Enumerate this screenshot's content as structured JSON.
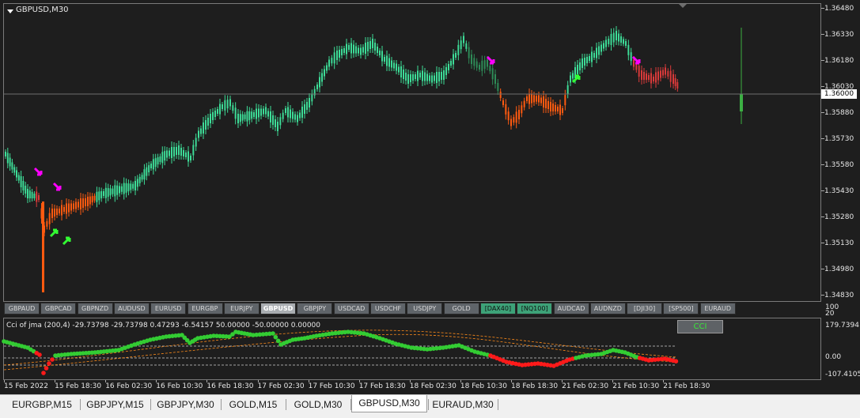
{
  "chart": {
    "symbol_label": "GBPUSD,M30",
    "current_price": "1.36000",
    "colors": {
      "background": "#1e1e1e",
      "bull_candle": "#3ddc97",
      "bear_candle": "#ff5a10",
      "neutral_candle": "#2e8b57",
      "down_arrow": "#ff00ff",
      "up_arrow": "#33ff33"
    },
    "price_axis": [
      "1.36480",
      "1.36330",
      "1.36180",
      "1.36030",
      "1.35880",
      "1.35730",
      "1.35580",
      "1.35430",
      "1.35280",
      "1.35130",
      "1.34980",
      "1.34830"
    ]
  },
  "symbol_buttons": [
    "GBPAUD",
    "GBPCAD",
    "GBPNZD",
    "AUDUSD",
    "EURUSD",
    "EURGBP",
    "EURJPY",
    "GBPUSD",
    "GBPJPY",
    "USDCAD",
    "USDCHF",
    "USDJPY",
    "GOLD",
    "[DAX40]",
    "[NQ100]",
    "AUDCAD",
    "AUDNZD",
    "[DJI30]",
    "[SP500]",
    "EURAUD"
  ],
  "symbol_buttons_active": "GBPUSD",
  "symbol_buttons_green": [
    "[DAX40]",
    "[NQ100]"
  ],
  "indicator": {
    "title": "Cci of jma (200,4) -29.73798 -29.73798 0.47293 -6.54157 50.00000 -50.00000 0.00000",
    "button_label": "CCI",
    "axis": [
      "100",
      "20",
      "179.73941",
      "0.00",
      "-107.41051"
    ],
    "colors": {
      "up": "#33cc33",
      "down": "#ff1a1a",
      "level": "#cfcfcf",
      "band": "#ff8c1a"
    }
  },
  "time_axis": [
    "15 Feb 2022",
    "15 Feb 18:30",
    "16 Feb 02:30",
    "16 Feb 10:30",
    "16 Feb 18:30",
    "17 Feb 02:30",
    "17 Feb 10:30",
    "17 Feb 18:30",
    "18 Feb 02:30",
    "18 Feb 10:30",
    "18 Feb 18:30",
    "21 Feb 02:30",
    "21 Feb 10:30",
    "21 Feb 18:30"
  ],
  "tabs": [
    "EURGBP,M15",
    "GBPJPY,M15",
    "GBPJPY,M30",
    "GOLD,M15",
    "GOLD,M30",
    "GBPUSD,M30",
    "EURAUD,M30"
  ],
  "active_tab": "GBPUSD,M30"
}
